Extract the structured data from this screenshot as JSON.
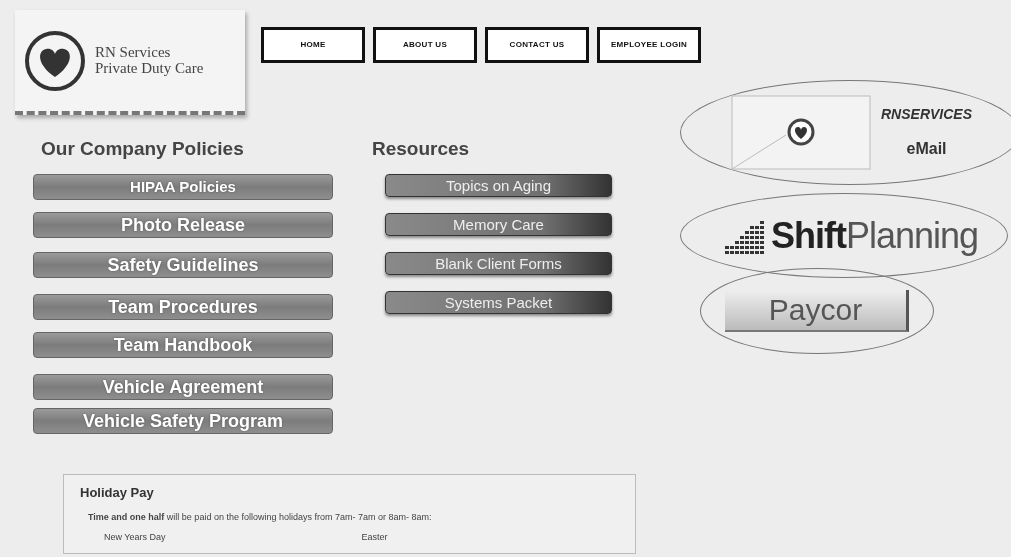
{
  "logo": {
    "line1": "RN Services",
    "line2": "Private Duty Care"
  },
  "nav": [
    "HOME",
    "ABOUT US",
    "CONTACT US",
    "EMPLOYEE LOGIN"
  ],
  "policies": {
    "title": "Our Company Policies",
    "items": [
      "HIPAA Policies",
      "Photo Release",
      "Safety Guidelines",
      "Team Procedures",
      "Team Handbook",
      "Vehicle Agreement",
      "Vehicle Safety Program"
    ]
  },
  "resources": {
    "title": "Resources",
    "items": [
      "Topics on Aging",
      "Memory Care",
      "Blank Client Forms",
      "Systems Packet"
    ]
  },
  "links": [
    {
      "kind": "email",
      "brand": "RNSERVICES",
      "label": "eMail"
    },
    {
      "kind": "shiftplanning",
      "brand": "Shift",
      "label": "Planning"
    },
    {
      "kind": "paycor",
      "label": "Paycor"
    }
  ],
  "holiday": {
    "title": "Holiday Pay",
    "intro": "**Time and one half** will be paid on the following holidays from 7am- 7am or 8am- 8am:",
    "days": [
      "New Years Day",
      "Easter"
    ]
  }
}
